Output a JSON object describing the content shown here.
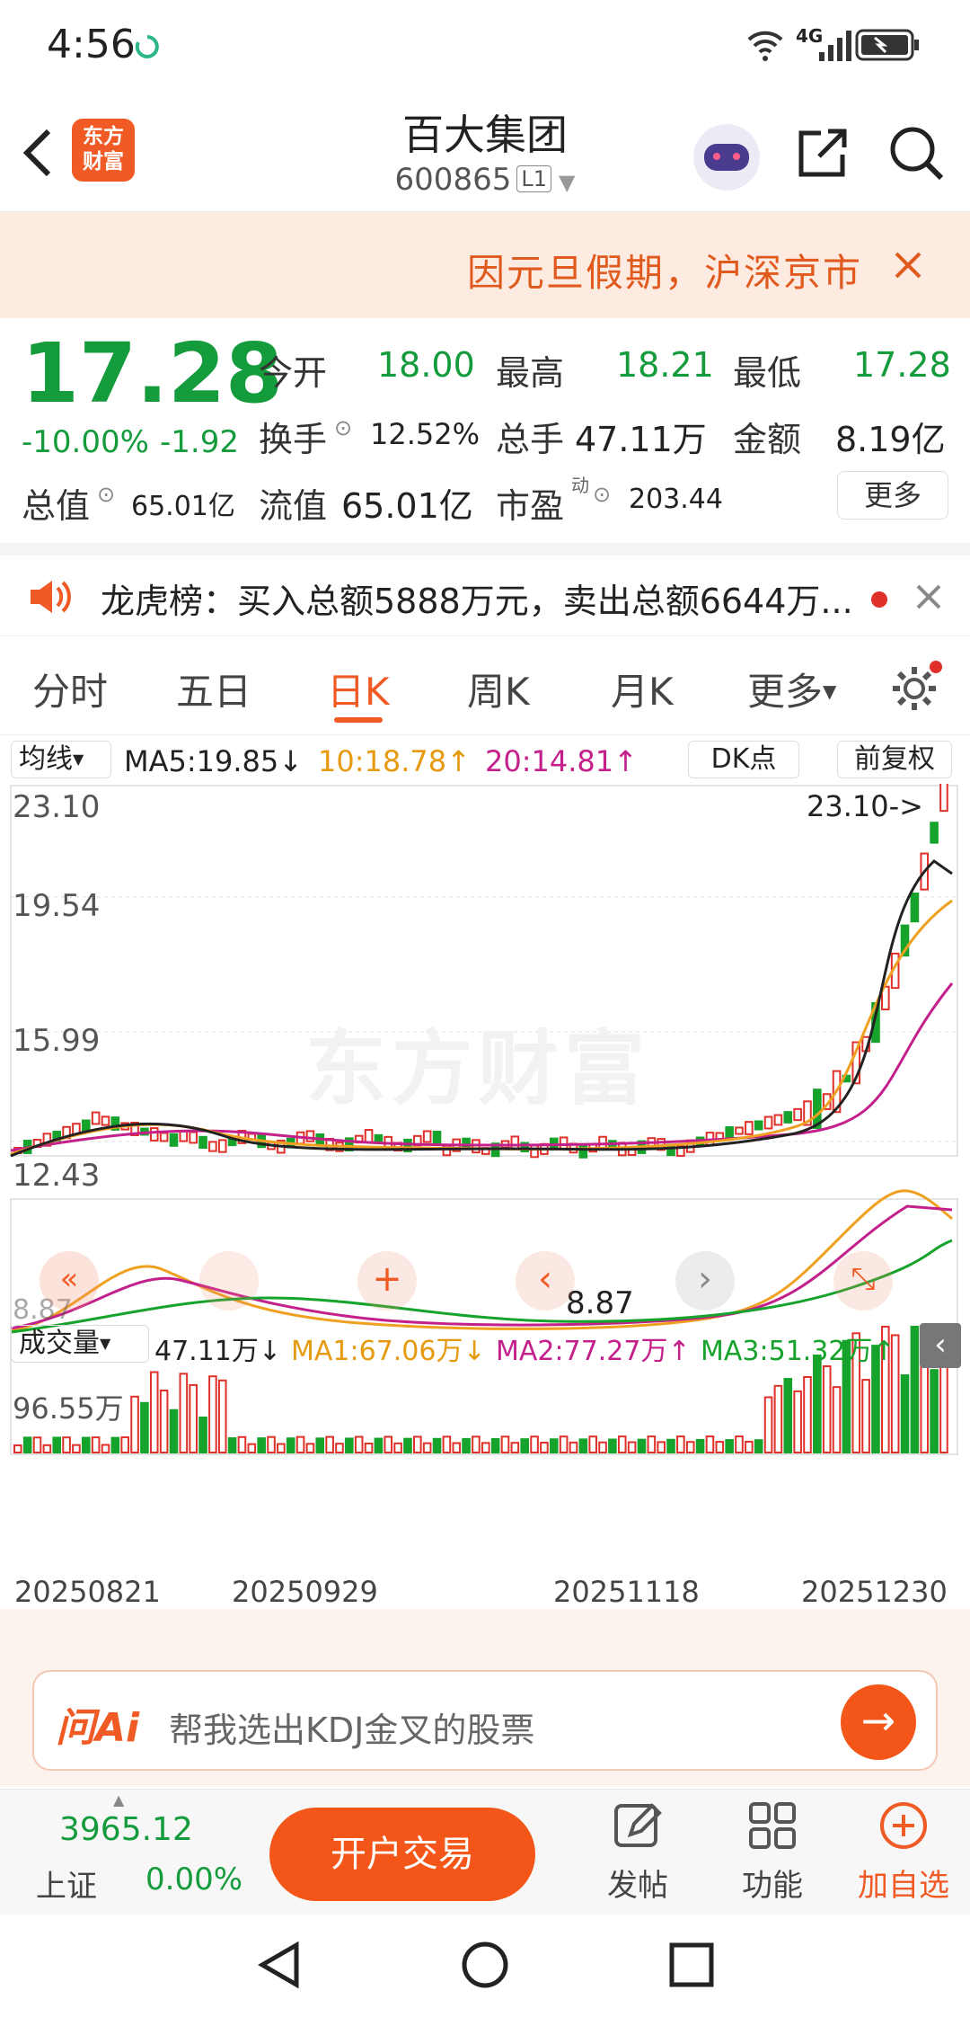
{
  "status": {
    "time": "4:56",
    "network": "4G"
  },
  "header": {
    "logo_text": "东方\n财富",
    "stock_name": "百大集团",
    "stock_code": "600865",
    "level_badge": "L1"
  },
  "banner": {
    "text": "因元旦假期，沪深京市场"
  },
  "quote": {
    "price": "17.28",
    "change_pct": "-10.00%",
    "change_abs": "-1.92",
    "open_label": "今开",
    "open": "18.00",
    "high_label": "最高",
    "high": "18.21",
    "low_label": "最低",
    "low": "17.28",
    "turnover_label": "换手",
    "turnover": "12.52%",
    "volume_label": "总手",
    "volume": "47.11万",
    "amount_label": "金额",
    "amount": "8.19亿",
    "mktcap_label": "总值",
    "mktcap": "65.01亿",
    "float_label": "流值",
    "float": "65.01亿",
    "pe_label": "市盈",
    "pe_sup": "动",
    "pe": "203.44",
    "more_label": "更多"
  },
  "dragon": {
    "text": "龙虎榜：买入总额5888万元，卖出总额6644万..."
  },
  "tabs": [
    {
      "label": "分时"
    },
    {
      "label": "五日"
    },
    {
      "label": "日K"
    },
    {
      "label": "周K"
    },
    {
      "label": "月K"
    },
    {
      "label": "更多"
    }
  ],
  "ma_bar": {
    "mode": "均线",
    "ma5": "MA5:19.85↓",
    "ma10": "10:18.78↑",
    "ma20": "20:14.81↑",
    "dk": "DK点",
    "adj": "前复权"
  },
  "price_axis": [
    "23.10",
    "19.54",
    "15.99",
    "12.43",
    "8.87"
  ],
  "chart_annotations": {
    "max": "23.10->",
    "min": "8.87",
    "watermark": "东方财富"
  },
  "vol_bar": {
    "mode": "成交量",
    "vol": "47.11万↓",
    "ma1": "MA1:67.06万↓",
    "ma2": "MA2:77.27万↑",
    "ma3": "MA3:51.32万↑",
    "vol_axis": "96.55万"
  },
  "date_axis": [
    "20250821",
    "20250929",
    "20251118",
    "20251230"
  ],
  "colors": {
    "up": "#e0302a",
    "down": "#16a32c",
    "ma5": "#222222",
    "ma10": "#f0a020",
    "ma20": "#c4208c",
    "accent": "#f05a24"
  },
  "ai": {
    "brand": "问Ai",
    "placeholder": "帮我选出KDJ金叉的股票"
  },
  "bottom": {
    "index_value": "3965.12",
    "index_name": "上证",
    "index_change": "0.00%",
    "trade_btn": "开户交易",
    "post": "发帖",
    "func": "功能",
    "watch": "加自选"
  },
  "chart_data": {
    "type": "candlestick",
    "x_labels": [
      "20250821",
      "20250929",
      "20251118",
      "20251230"
    ],
    "ylim": [
      8.87,
      23.1
    ],
    "max_label": "23.10",
    "min_label": "8.87",
    "last_close": 17.28,
    "ma": {
      "MA5": 19.85,
      "MA10": 18.78,
      "MA20": 14.81
    },
    "volume_max": "96.55万",
    "volume_last": "47.11万"
  }
}
